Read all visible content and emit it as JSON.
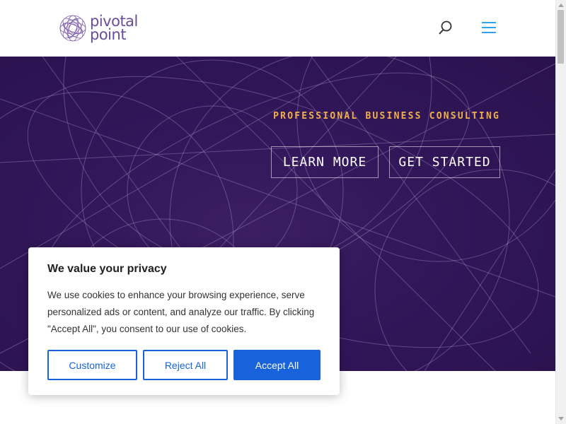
{
  "header": {
    "logo_text": "pivotal\npoint",
    "search_icon": "search-icon",
    "menu_icon": "hamburger-menu-icon"
  },
  "hero": {
    "tagline": "PROFESSIONAL BUSINESS CONSULTING",
    "learn_more": "LEARN MORE",
    "get_started": "GET STARTED"
  },
  "cookie": {
    "title": "We value your privacy",
    "body": "We use cookies to enhance your browsing experience, serve personalized ads or content, and analyze our traffic. By clicking \"Accept All\", you consent to our use of cookies.",
    "customize": "Customize",
    "reject": "Reject All",
    "accept": "Accept All"
  },
  "colors": {
    "brand": "#6a4c9c",
    "hero_bg": "#32175a",
    "accent": "#f2b04a",
    "primary_button": "#1863dc"
  }
}
